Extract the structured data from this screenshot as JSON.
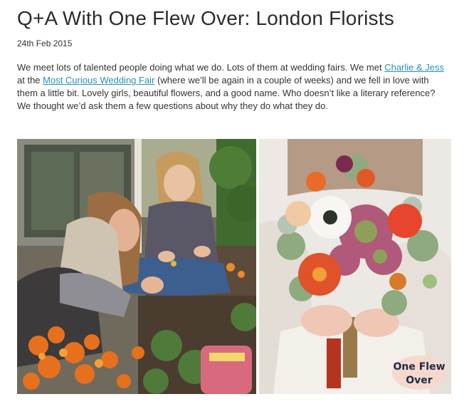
{
  "post": {
    "title": "Q+A With One Flew Over: London Florists",
    "date": "24th Feb 2015",
    "intro": {
      "part1": "We meet lots of talented people doing what we do. Lots of them at wedding fairs. We met ",
      "link1": "Charlie & Jess",
      "part2": " at the ",
      "link2": "Most Curious Wedding Fair",
      "part3": " (where we’ll be again in a couple of weeks) and we fell in love with them a little bit. Lovely girls, beautiful flowers, and a good name. Who doesn’t like a literary reference? We thought we’d ask them a few questions about why they do what they do."
    }
  },
  "images": {
    "left": {
      "icon": "florists-working-photo"
    },
    "right": {
      "icon": "bouquet-photo",
      "logo_line1": "One Flew",
      "logo_line2": "Over"
    }
  },
  "colors": {
    "link": "#2a8fb5",
    "text": "#333333",
    "logo_blob": "#f5d9cf",
    "logo_text": "#1e2a44"
  }
}
